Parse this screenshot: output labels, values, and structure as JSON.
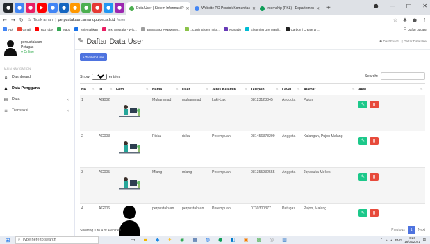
{
  "browser": {
    "active_tab": "Data User | Sistem Informasi P",
    "tabs": [
      {
        "label": "Website PO Pondok Komunitas",
        "color": "#4285f4"
      },
      {
        "label": "Internship (PKL) - Departemen",
        "color": "#0f9d58"
      }
    ],
    "security_label": "Tidak aman",
    "url_domain": "perpustakaan.smainupujon.sch.id",
    "url_path": "/user",
    "bookmarks": [
      {
        "label": "Apl",
        "color": "#4285f4"
      },
      {
        "label": "Gmail",
        "color": "#ea4335"
      },
      {
        "label": "YouTube",
        "color": "#ff0000"
      },
      {
        "label": "Maps",
        "color": "#34a853"
      },
      {
        "label": "Terjemahkan",
        "color": "#1a73e8"
      },
      {
        "label": "Text Australia - Wik...",
        "color": "#e91e63"
      },
      {
        "label": "[BIMASAKI PREMIUM...",
        "color": "#9e9e9e"
      },
      {
        "label": ".: Login Sistem Info...",
        "color": "#8bc34a"
      },
      {
        "label": "Nomado",
        "color": "#673ab7"
      },
      {
        "label": "Elearning UIN Mauli...",
        "color": "#00bcd4"
      },
      {
        "label": "Carbon | Create an...",
        "color": "#212121"
      }
    ],
    "bookmark_other": "Daftar bacaan"
  },
  "sidebar": {
    "profile_name": "perpustakaan",
    "profile_role": "Petugas",
    "profile_status": "Online",
    "section_label": "MAIN NAVIGATION",
    "items": [
      {
        "label": "Dashboard",
        "icon": "home-icon",
        "glyph": "⌂",
        "active": false,
        "chevron": false
      },
      {
        "label": "Data Pengguna",
        "icon": "user-icon",
        "glyph": "♟",
        "active": true,
        "chevron": false
      },
      {
        "label": "Data",
        "icon": "database-icon",
        "glyph": "▤",
        "active": false,
        "chevron": true
      },
      {
        "label": "Transaksi",
        "icon": "list-icon",
        "glyph": "≡",
        "active": false,
        "chevron": true
      }
    ]
  },
  "page": {
    "title": "Daftar Data User",
    "breadcrumb_home": "Dashboard",
    "breadcrumb_current": "Daftar Data User",
    "add_button": "+ Tambah User",
    "show_label": "Show",
    "show_value": "10",
    "entries_label": "entries",
    "search_label": "Search:",
    "columns": [
      "No",
      "ID",
      "Foto",
      "Nama",
      "User",
      "Jenis Kelamin",
      "Telepon",
      "Level",
      "Alamat",
      "Aksi"
    ],
    "rows": [
      {
        "no": "1",
        "id": "AG002",
        "photo": "illustration",
        "nama": "Muhammad",
        "user": "muhammad",
        "jk": "Laki-Laki",
        "telepon": "08123123345",
        "level": "Anggota",
        "alamat": "Pujon"
      },
      {
        "no": "2",
        "id": "AG003",
        "photo": "illustration",
        "nama": "Riska",
        "user": "riska",
        "jk": "Perempuan",
        "telepon": "081456378299",
        "level": "Anggota",
        "alamat": "Kalangan, Pujon Malang"
      },
      {
        "no": "3",
        "id": "AG005",
        "photo": "illustration",
        "nama": "Mlang",
        "user": "mlang",
        "jk": "Perempuan",
        "telepon": "081355932555",
        "level": "Anggota",
        "alamat": "Jayasuka Mekes"
      },
      {
        "no": "4",
        "id": "AG006",
        "photo": "avatar",
        "nama": "perpustakaan",
        "user": "perpustakaan",
        "jk": "Perempuan",
        "telepon": "0730300377",
        "level": "Petugas",
        "alamat": "Pujon, Malang"
      }
    ],
    "footer_info": "Showing 1 to 4 of 4 entries",
    "pager_prev": "Previous",
    "pager_current": "1",
    "pager_next": "Next"
  },
  "taskbar": {
    "search_placeholder": "Type here to search",
    "time": "6:26",
    "date": "16/06/2021",
    "lang": "ENG"
  },
  "colors": {
    "primary": "#4e73df",
    "success": "#1cc88a",
    "danger": "#e74a3b"
  }
}
